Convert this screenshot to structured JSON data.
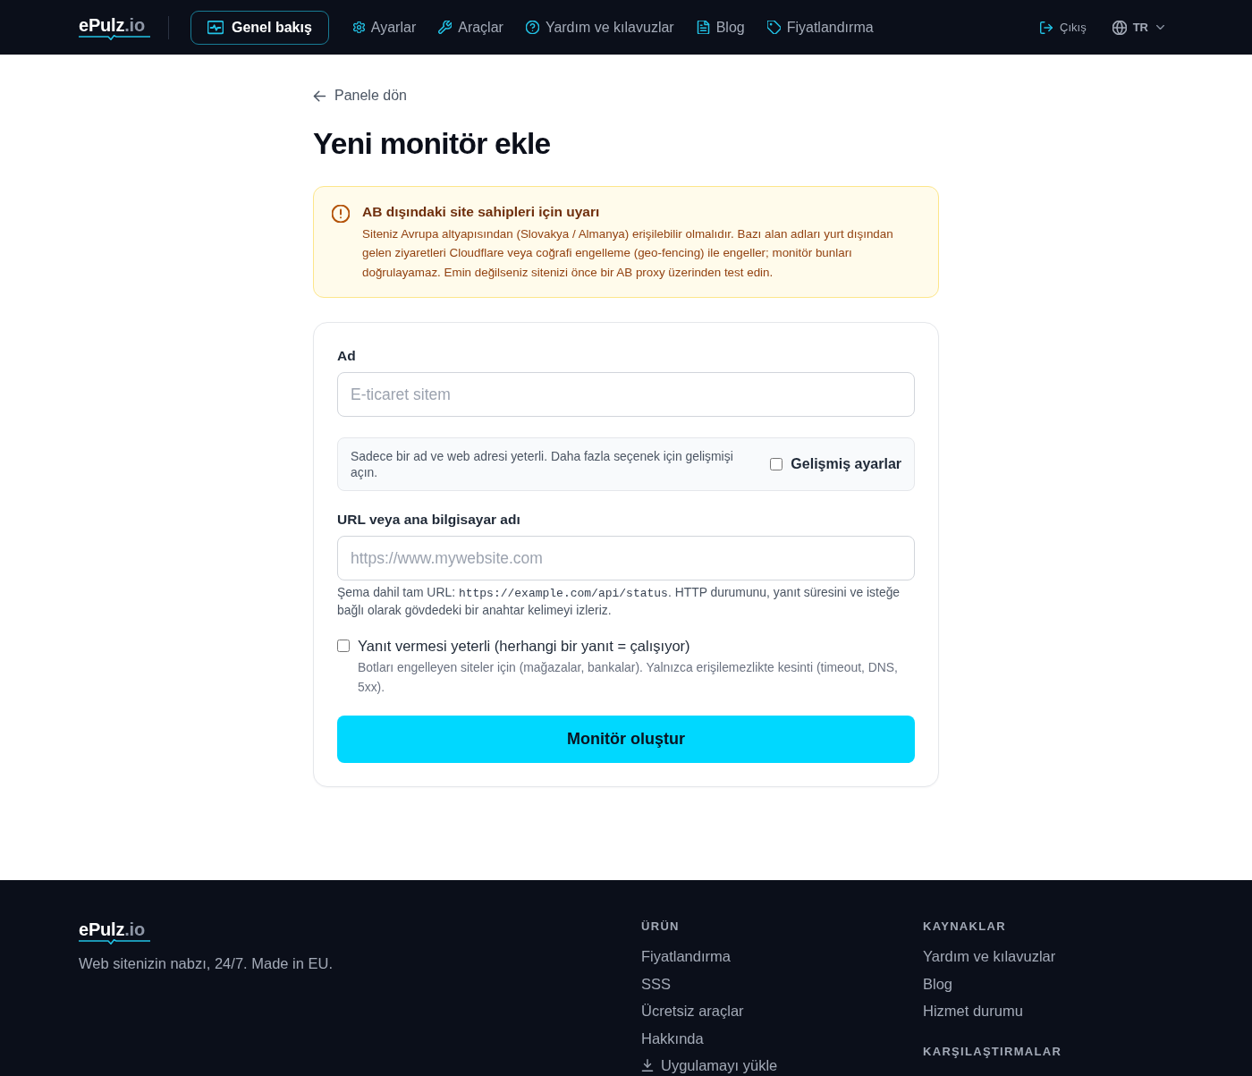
{
  "header": {
    "logo": {
      "name": "ePulz",
      "suffix": ".io"
    },
    "nav": [
      {
        "label": "Genel bakış",
        "selected": true
      },
      {
        "label": "Ayarlar",
        "selected": false
      },
      {
        "label": "Araçlar",
        "selected": false
      },
      {
        "label": "Yardım ve kılavuzlar",
        "selected": false
      },
      {
        "label": "Blog",
        "selected": false
      },
      {
        "label": "Fiyatlandırma",
        "selected": false
      }
    ],
    "logout": "Çıkış",
    "language": "TR"
  },
  "back_link": "Panele dön",
  "title": "Yeni monitör ekle",
  "warning": {
    "title": "AB dışındaki site sahipleri için uyarı",
    "text": "Siteniz Avrupa altyapısından (Slovakya / Almanya) erişilebilir olmalıdır. Bazı alan adları yurt dışından gelen ziyaretleri Cloudflare veya coğrafi engelleme (geo-fencing) ile engeller; monitör bunları doğrulayamaz. Emin değilseniz sitenizi önce bir AB proxy üzerinden test edin."
  },
  "form": {
    "name_field": {
      "label": "Ad",
      "placeholder": "E-ticaret sitem"
    },
    "advanced": {
      "text": "Sadece bir ad ve web adresi yeterli. Daha fazla seçenek için gelişmişi açın.",
      "label": "Gelişmiş ayarlar",
      "checked": false
    },
    "url_field": {
      "label": "URL veya ana bilgisayar adı",
      "placeholder": "https://www.mywebsite.com",
      "hint": {
        "before": "Şema dahil tam URL:",
        "code": "https://example.com/api/status",
        "after": ". HTTP durumunu, yanıt süresini ve isteğe bağlı olarak gövdedeki bir anahtar kelimeyi izleriz."
      }
    },
    "response_only": {
      "label": "Yanıt vermesi yeterli (herhangi bir yanıt = çalışıyor)",
      "description": "Botları engelleyen siteler için (mağazalar, bankalar). Yalnızca erişilemezlikte kesinti (timeout, DNS, 5xx).",
      "checked": false
    },
    "submit": "Monitör oluştur"
  },
  "footer": {
    "logo": {
      "name": "ePulz",
      "suffix": ".io"
    },
    "tagline": "Web sitenizin nabzı, 24/7. Made in EU.",
    "columns": [
      {
        "sections": [
          {
            "heading": "ÜRÜN",
            "links": [
              {
                "label": "Fiyatlandırma",
                "kind": "link"
              },
              {
                "label": "SSS",
                "kind": "link"
              },
              {
                "label": "Ücretsiz araçlar",
                "kind": "link"
              },
              {
                "label": "Hakkında",
                "kind": "link"
              },
              {
                "label": "Uygulamayı yükle",
                "kind": "download"
              }
            ]
          }
        ]
      },
      {
        "sections": [
          {
            "heading": "KAYNAKLAR",
            "links": [
              {
                "label": "Yardım ve kılavuzlar",
                "kind": "link"
              },
              {
                "label": "Blog",
                "kind": "link"
              },
              {
                "label": "Hizmet durumu",
                "kind": "link"
              }
            ]
          },
          {
            "heading": "KARŞILAŞTIRMALAR"
          }
        ]
      }
    ]
  }
}
